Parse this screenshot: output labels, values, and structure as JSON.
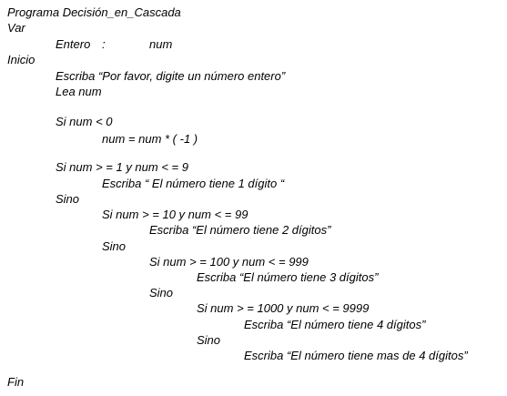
{
  "document": {
    "lines": [
      "Programa Decisión_en_Cascada",
      "Var",
      "Entero",
      ":",
      "num",
      "Inicio",
      "Escriba “Por favor, digite un número entero”",
      "Lea num",
      "Si num < 0",
      "num = num * ( -1 )",
      "Si num > = 1 y num < = 9",
      "Escriba “ El número tiene 1 dígito “",
      "Sino",
      "Si num > = 10 y num < = 99",
      "Escriba “El número tiene 2 dígitos”",
      "Sino",
      "Si num > = 100 y num < = 999",
      "Escriba “El número tiene 3 dígitos”",
      "Sino",
      "Si num > = 1000 y num < = 9999",
      "Escriba “El número tiene 4 dígitos”",
      "Sino",
      "Escriba “El número tiene mas de 4 dígitos”",
      "Fin"
    ]
  }
}
